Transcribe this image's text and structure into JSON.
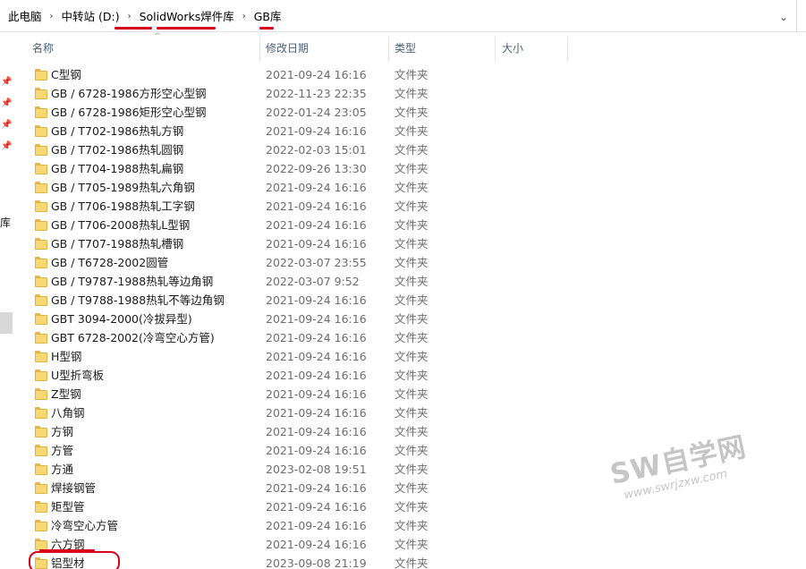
{
  "breadcrumb": {
    "items": [
      "此电脑",
      "中转站 (D:)",
      "SolidWorks焊件库",
      "GB库"
    ],
    "separator": "›",
    "dropdown_icon": "chevron-down-icon"
  },
  "nav": {
    "pins": [
      "pin-icon",
      "pin-icon",
      "pin-icon",
      "pin-icon"
    ],
    "library_fragment": "库"
  },
  "columns": {
    "name": "名称",
    "date": "修改日期",
    "type": "类型",
    "size": "大小"
  },
  "rows": [
    {
      "name": "C型钢",
      "date": "2021-09-24 16:16",
      "type": "文件夹"
    },
    {
      "name": "GB / 6728-1986方形空心型钢",
      "date": "2022-11-23 22:35",
      "type": "文件夹"
    },
    {
      "name": "GB / 6728-1986矩形空心型钢",
      "date": "2022-01-24 23:05",
      "type": "文件夹"
    },
    {
      "name": "GB / T702-1986热轧方钢",
      "date": "2021-09-24 16:16",
      "type": "文件夹"
    },
    {
      "name": "GB / T702-1986热轧圆钢",
      "date": "2022-02-03 15:01",
      "type": "文件夹"
    },
    {
      "name": "GB / T704-1988热轧扁钢",
      "date": "2022-09-26 13:30",
      "type": "文件夹"
    },
    {
      "name": "GB / T705-1989热轧六角钢",
      "date": "2021-09-24 16:16",
      "type": "文件夹"
    },
    {
      "name": "GB / T706-1988热轧工字钢",
      "date": "2021-09-24 16:16",
      "type": "文件夹"
    },
    {
      "name": "GB / T706-2008热轧L型钢",
      "date": "2021-09-24 16:16",
      "type": "文件夹"
    },
    {
      "name": "GB / T707-1988热轧槽钢",
      "date": "2021-09-24 16:16",
      "type": "文件夹"
    },
    {
      "name": "GB / T6728-2002圆管",
      "date": "2022-03-07 23:55",
      "type": "文件夹"
    },
    {
      "name": "GB / T9787-1988热轧等边角钢",
      "date": "2022-03-07 9:52",
      "type": "文件夹"
    },
    {
      "name": "GB / T9788-1988热轧不等边角钢",
      "date": "2021-09-24 16:16",
      "type": "文件夹"
    },
    {
      "name": "GBT 3094-2000(冷拔异型)",
      "date": "2021-09-24 16:16",
      "type": "文件夹"
    },
    {
      "name": "GBT 6728-2002(冷弯空心方管)",
      "date": "2021-09-24 16:16",
      "type": "文件夹"
    },
    {
      "name": "H型钢",
      "date": "2021-09-24 16:16",
      "type": "文件夹"
    },
    {
      "name": "U型折弯板",
      "date": "2021-09-24 16:16",
      "type": "文件夹"
    },
    {
      "name": "Z型钢",
      "date": "2021-09-24 16:16",
      "type": "文件夹"
    },
    {
      "name": "八角钢",
      "date": "2021-09-24 16:16",
      "type": "文件夹"
    },
    {
      "name": "方钢",
      "date": "2021-09-24 16:16",
      "type": "文件夹"
    },
    {
      "name": "方管",
      "date": "2021-09-24 16:16",
      "type": "文件夹"
    },
    {
      "name": "方通",
      "date": "2023-02-08 19:51",
      "type": "文件夹"
    },
    {
      "name": "焊接钢管",
      "date": "2021-09-24 16:16",
      "type": "文件夹"
    },
    {
      "name": "矩型管",
      "date": "2021-09-24 16:16",
      "type": "文件夹"
    },
    {
      "name": "冷弯空心方管",
      "date": "2021-09-24 16:16",
      "type": "文件夹"
    },
    {
      "name": "六方钢",
      "date": "2021-09-24 16:16",
      "type": "文件夹"
    },
    {
      "name": "铝型材",
      "date": "2023-09-08 21:19",
      "type": "文件夹"
    }
  ],
  "watermark": {
    "main": "SW自学网",
    "url": "www.swrjzxw.com"
  },
  "colors": {
    "annotation": "#d9001b",
    "folder": "#f8d775",
    "header_text": "#4c607a"
  }
}
